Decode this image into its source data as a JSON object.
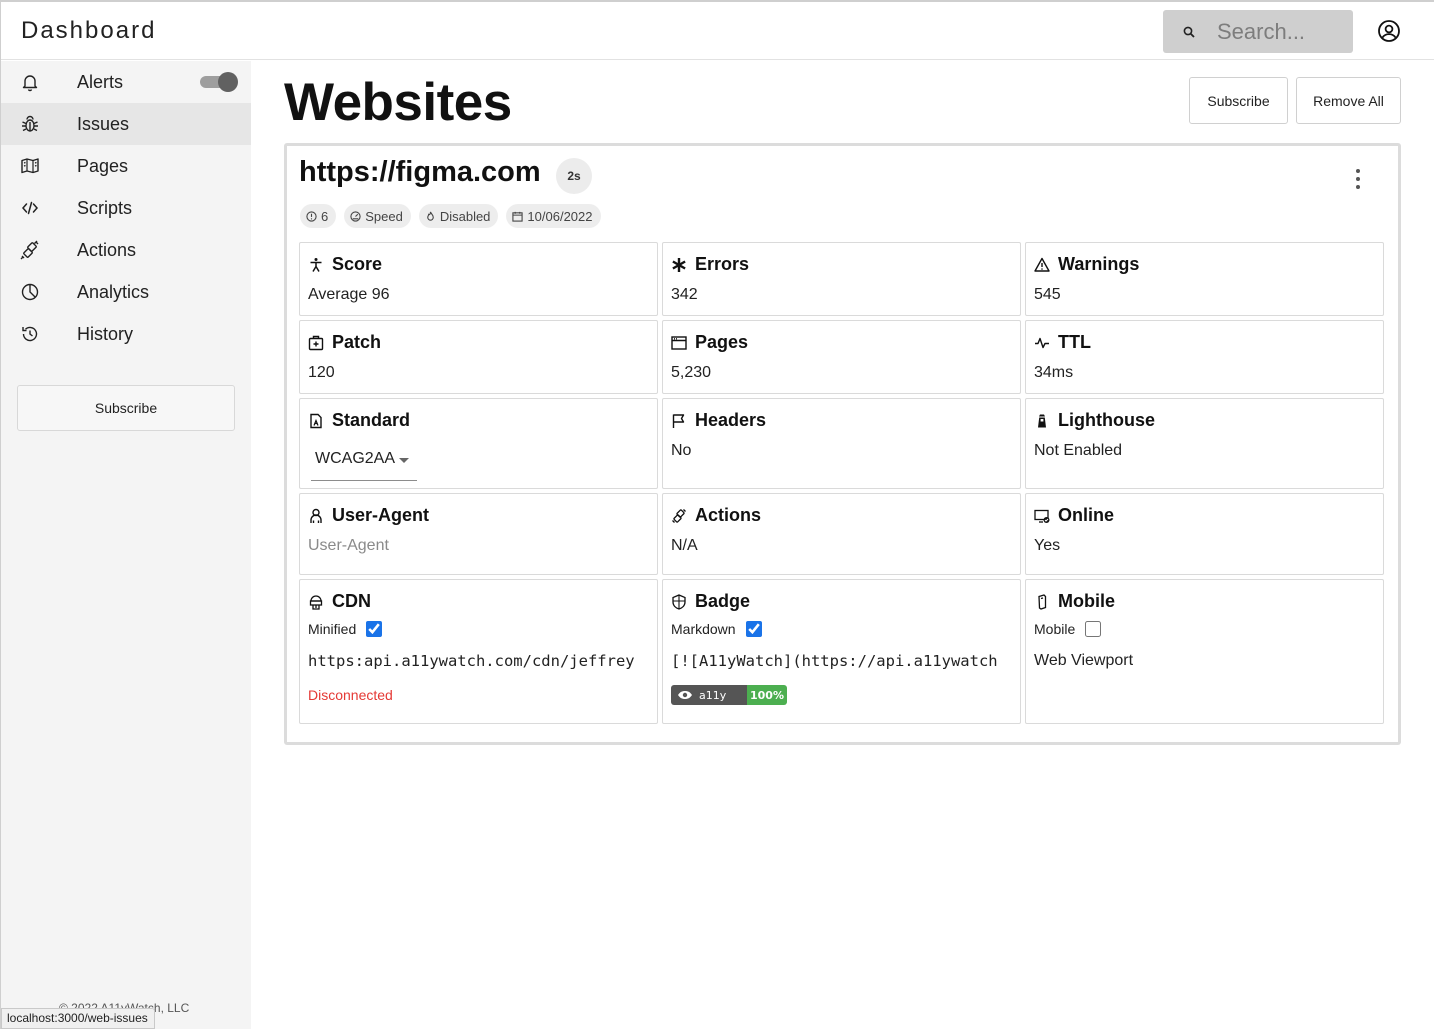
{
  "topbar": {
    "brand": "Dashboard",
    "search_placeholder": "Search..."
  },
  "sidebar": {
    "items": [
      {
        "label": "Alerts",
        "icon": "bell-icon",
        "toggle_on": true
      },
      {
        "label": "Issues",
        "icon": "bug-icon",
        "active": true
      },
      {
        "label": "Pages",
        "icon": "book-icon"
      },
      {
        "label": "Scripts",
        "icon": "code-icon"
      },
      {
        "label": "Actions",
        "icon": "plug-icon"
      },
      {
        "label": "Analytics",
        "icon": "pie-chart-icon"
      },
      {
        "label": "History",
        "icon": "history-icon"
      }
    ],
    "subscribe_label": "Subscribe",
    "copyright": "© 2022 A11yWatch, LLC",
    "status_url": "localhost:3000/web-issues"
  },
  "main": {
    "title": "Websites",
    "subscribe_label": "Subscribe",
    "remove_all_label": "Remove All"
  },
  "website": {
    "url": "https://figma.com",
    "duration": "2s",
    "chips": {
      "issues": "6",
      "speed": "Speed",
      "status": "Disabled",
      "date": "10/06/2022"
    },
    "cells": {
      "score": {
        "title": "Score",
        "value": "Average 96"
      },
      "errors": {
        "title": "Errors",
        "value": "342"
      },
      "warnings": {
        "title": "Warnings",
        "value": "545"
      },
      "patch": {
        "title": "Patch",
        "value": "120"
      },
      "pages": {
        "title": "Pages",
        "value": "5,230"
      },
      "ttl": {
        "title": "TTL",
        "value": "34ms"
      },
      "standard": {
        "title": "Standard",
        "value": "WCAG2AA"
      },
      "headers": {
        "title": "Headers",
        "value": "No"
      },
      "lighthouse": {
        "title": "Lighthouse",
        "value": "Not Enabled"
      },
      "user_agent": {
        "title": "User-Agent",
        "placeholder": "User-Agent"
      },
      "actions": {
        "title": "Actions",
        "value": "N/A"
      },
      "online": {
        "title": "Online",
        "value": "Yes"
      },
      "cdn": {
        "title": "CDN",
        "checkbox_label": "Minified",
        "checked": true,
        "url": "https:api.a11ywatch.com/cdn/jeffrey",
        "status": "Disconnected"
      },
      "badge": {
        "title": "Badge",
        "checkbox_label": "Markdown",
        "checked": true,
        "markdown": "[![A11yWatch](https://api.a11ywatch",
        "badge_left": "a11y",
        "badge_right": "100%"
      },
      "mobile": {
        "title": "Mobile",
        "checkbox_label": "Mobile",
        "checked": false,
        "value": "Web Viewport"
      }
    }
  },
  "colors": {
    "accent": "#1a73e8",
    "error": "#e53935",
    "badge_green": "#4caf50",
    "sidebar_bg": "#f4f4f4"
  }
}
